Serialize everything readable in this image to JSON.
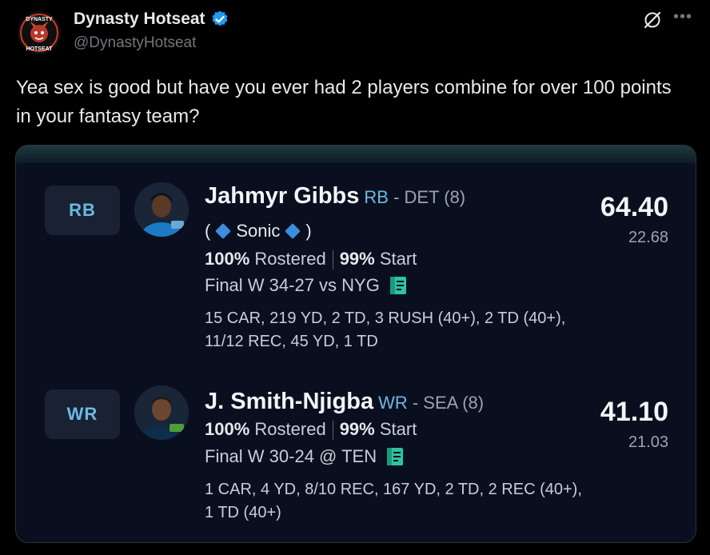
{
  "author": {
    "name": "Dynasty Hotseat",
    "handle": "@DynastyHotseat",
    "avatar_text_top": "DYNASTY",
    "avatar_text_bottom": "HOTSEAT"
  },
  "tweet": {
    "text": "Yea sex is good but have you ever had 2 players combine for over 100 points in your fantasy team?"
  },
  "icons": {
    "verified": "verified-badge-icon",
    "grok": "grok-icon",
    "more": "more-icon",
    "notes": "notes-icon",
    "diamond": "diamond-icon"
  },
  "colors": {
    "verified": "#1d9bf0",
    "position": "#6bb9e0",
    "note_icon": "#2ec4a0",
    "diamond": "#3b8ddd"
  },
  "players": [
    {
      "pos_badge": "RB",
      "name": "Jahmyr Gibbs",
      "pos": "RB",
      "team_info": "- DET (8)",
      "nickname_open": "(",
      "nickname": "Sonic",
      "nickname_close": ")",
      "rostered_pct": "100%",
      "rostered_label": "Rostered",
      "start_pct": "99%",
      "start_label": "Start",
      "final": "Final W 34-27 vs NYG",
      "stats_line1": "15 CAR, 219 YD, 2 TD, 3 RUSH (40+), 2 TD (40+),",
      "stats_line2": "11/12 REC, 45 YD, 1 TD",
      "score": "64.40",
      "projection": "22.68"
    },
    {
      "pos_badge": "WR",
      "name": "J. Smith-Njigba",
      "pos": "WR",
      "team_info": "- SEA (8)",
      "rostered_pct": "100%",
      "rostered_label": "Rostered",
      "start_pct": "99%",
      "start_label": "Start",
      "final": "Final W 30-24 @ TEN",
      "stats_line1": "1 CAR, 4 YD, 8/10 REC, 167 YD, 2 TD, 2 REC (40+),",
      "stats_line2": "1 TD (40+)",
      "score": "41.10",
      "projection": "21.03"
    }
  ]
}
